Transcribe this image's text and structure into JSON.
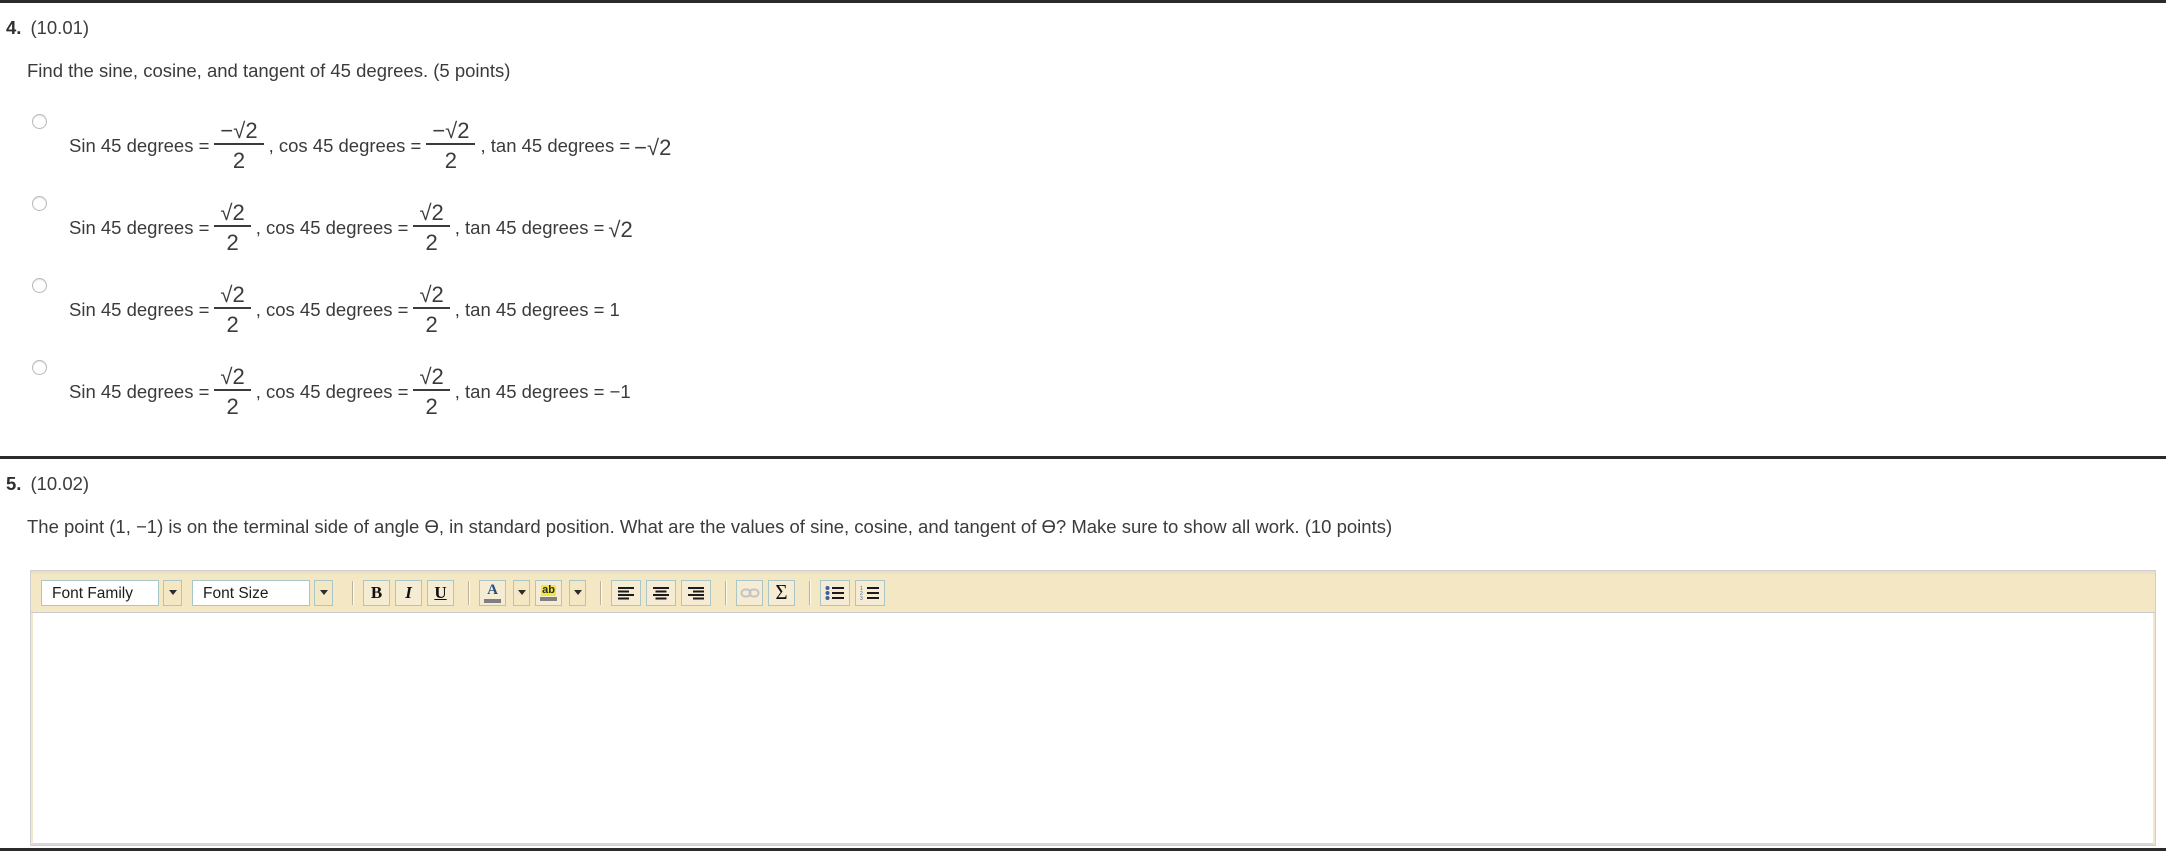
{
  "questions": [
    {
      "number": "4.",
      "code": "(10.01)",
      "prompt": "Find the sine, cosine, and tangent of 45 degrees. (5 points)",
      "options": [
        {
          "sin_label": "Sin 45 degrees  = ",
          "sin_num": "−√2",
          "sin_den": "2",
          "cos_label": ", cos 45 degrees  = ",
          "cos_num": "−√2",
          "cos_den": "2",
          "tan_label": ", tan 45 degrees  = ",
          "tan_value": "−√2",
          "tan_is_radical": true
        },
        {
          "sin_label": "Sin 45 degrees  = ",
          "sin_num": "√2",
          "sin_den": "2",
          "cos_label": ", cos 45 degrees  = ",
          "cos_num": "√2",
          "cos_den": "2",
          "tan_label": ", tan 45 degrees  = ",
          "tan_value": "√2",
          "tan_is_radical": true
        },
        {
          "sin_label": "Sin 45 degrees  = ",
          "sin_num": "√2",
          "sin_den": "2",
          "cos_label": ", cos 45 degrees  = ",
          "cos_num": "√2",
          "cos_den": "2",
          "tan_label": ", tan 45 degrees  = 1",
          "tan_value": "",
          "tan_is_radical": false
        },
        {
          "sin_label": "Sin 45 degrees  = ",
          "sin_num": "√2",
          "sin_den": "2",
          "cos_label": ", cos 45 degrees  = ",
          "cos_num": "√2",
          "cos_den": "2",
          "tan_label": ", tan 45 degrees  = −1",
          "tan_value": "",
          "tan_is_radical": false
        }
      ]
    },
    {
      "number": "5.",
      "code": "(10.02)",
      "prompt": "The point (1, −1) is on the terminal side of angle Ө, in standard position. What are the values of sine, cosine, and tangent of Ө? Make sure to show all work. (10 points)"
    }
  ],
  "editor": {
    "font_family_value": "Font Family",
    "font_size_value": "Font Size",
    "bold_label": "B",
    "italic_label": "I",
    "underline_label": "U",
    "text_color_glyph": "A",
    "highlight_glyph": "ab",
    "sigma_label": "Σ",
    "content": ""
  },
  "colors": {
    "toolbar_bg": "#f4e7c4",
    "button_border": "#a9c6c8",
    "text": "#3b3b3b",
    "rule": "#2b2b2b",
    "highlight_yellow": "#f3e63c",
    "color_glyph_blue": "#27507e"
  }
}
